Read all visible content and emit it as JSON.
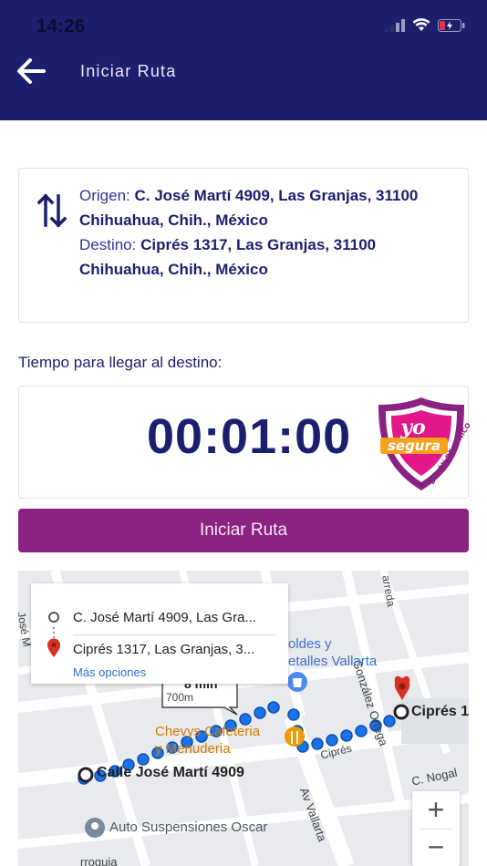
{
  "status_bar": {
    "time": "14:26"
  },
  "header": {
    "title": "Iniciar Ruta"
  },
  "route": {
    "origin_label": "Origen: ",
    "origin_value": "C. José Martí 4909, Las Granjas, 31100 Chihuahua, Chih., México",
    "dest_label": "Destino: ",
    "dest_value": "Ciprés 1317, Las Granjas, 31100 Chihuahua, Chih., México"
  },
  "time_section": {
    "label": "Tiempo para llegar al destino:",
    "value": "00:01:00"
  },
  "badge": {
    "line1": "yo",
    "line2": "segura",
    "curve_text": "BOTÓN DE PÁNICO"
  },
  "start_button": {
    "label": "Iniciar Ruta"
  },
  "map": {
    "popup": {
      "origin": "C. José Martí 4909, Las Gra...",
      "destination": "Ciprés 1317, Las Granjas, 3...",
      "more": "Más opciones"
    },
    "labels": {
      "street_start": "Calle José Martí 4909",
      "street_dest": "Ciprés 1",
      "chevys": "Chevys Cafeteria",
      "chevys2": "y Menuderia",
      "auto": "Auto Suspensiones Oscar",
      "vallarta": "Av Vallarta",
      "gonzalez": "González Ortega",
      "nogal": "C. Nogal",
      "cipres_street": "Ciprés",
      "regalos": "oldes y",
      "detalles": "etalles Vallarta",
      "route_time": "8 min",
      "route_dist": "700m",
      "arreda": "arreda",
      "jose": "José M",
      "bottom": "rroquia"
    },
    "zoom_in": "+",
    "zoom_out": "−"
  },
  "colors": {
    "navy": "#1a1f6e",
    "purple": "#8a2282",
    "route_blue": "#1a73e8"
  }
}
